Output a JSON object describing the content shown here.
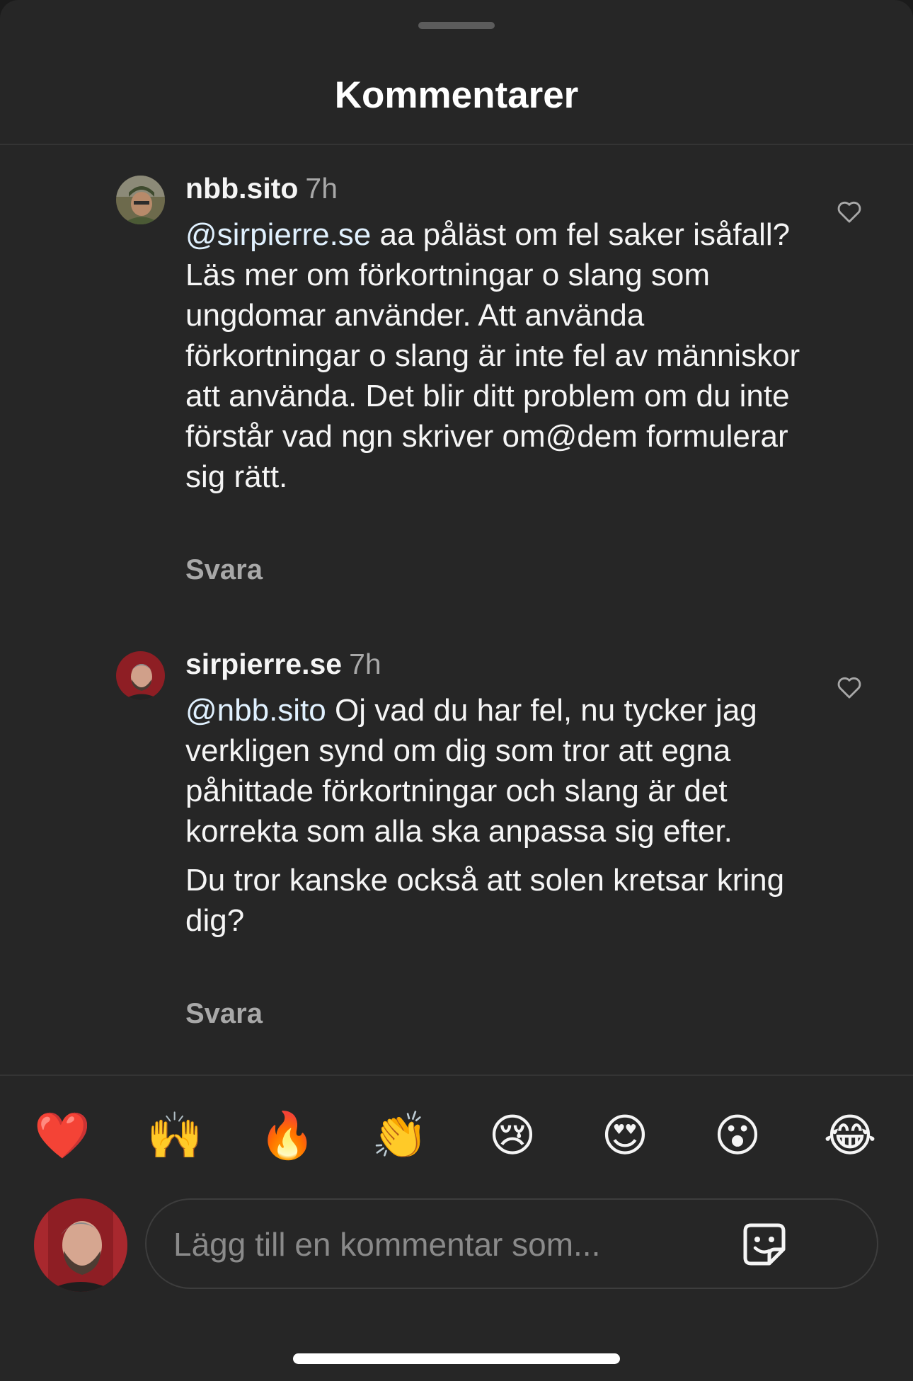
{
  "header": {
    "title": "Kommentarer"
  },
  "comments": [
    {
      "username": "nbb.sito",
      "time": "7h",
      "mention": "@sirpierre.se",
      "paragraphs": [
        "aa påläst om fel saker isåfall? Läs mer om förkortningar o slang som ungdomar använder. Att använda förkortningar o slang är inte fel av människor att använda. Det blir ditt problem om du inte förstår vad ngn skriver om@dem formulerar sig rätt."
      ],
      "reply_label": "Svara",
      "like_icon": "heart-outline-icon"
    },
    {
      "username": "sirpierre.se",
      "time": "7h",
      "mention": "@nbb.sito",
      "paragraphs": [
        "Oj vad du har fel, nu tycker jag verkligen synd om dig som tror att egna påhittade förkortningar och slang är det korrekta som alla ska anpassa sig efter.",
        "Du tror kanske också att solen kretsar kring dig?"
      ],
      "reply_label": "Svara",
      "like_icon": "heart-outline-icon"
    }
  ],
  "quick_reactions": [
    "❤️",
    "🙌",
    "🔥",
    "👏",
    "😢",
    "😍",
    "😮",
    "😂"
  ],
  "composer": {
    "placeholder": "Lägg till en kommentar som...",
    "sticker_icon": "sticker-icon"
  },
  "colors": {
    "background": "#262626",
    "text": "#f5f5f5",
    "secondary": "#a8a8a8",
    "mention": "#e0f1ff"
  }
}
